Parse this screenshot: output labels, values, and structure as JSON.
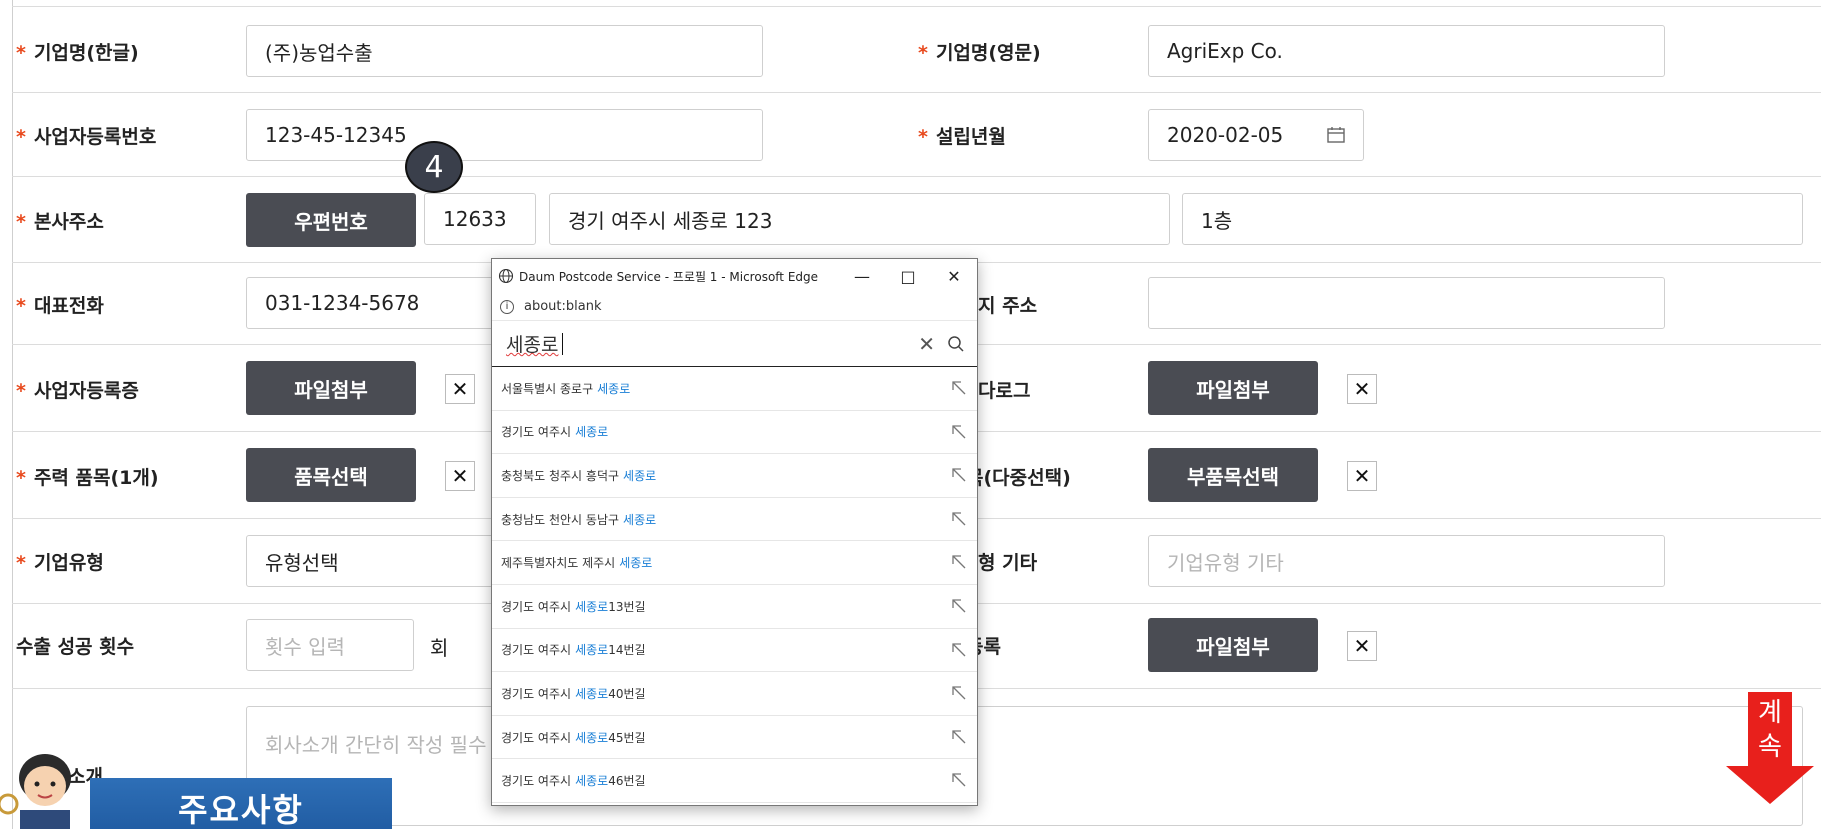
{
  "form": {
    "company_name_kr": {
      "label": "기업명(한글)",
      "value": "(주)농업수출"
    },
    "company_name_en": {
      "label": "기업명(영문)",
      "value": "AgriExp Co."
    },
    "business_reg_no": {
      "label": "사업자등록번호",
      "value": "123-45-12345"
    },
    "founded": {
      "label": "설립년월",
      "value": "2020-02-05"
    },
    "hq_address": {
      "label": "본사주소",
      "postcode_button": "우편번호",
      "postcode": "12633",
      "address": "경기 여주시 세종로 123",
      "detail": "1층"
    },
    "phone": {
      "label": "대표전화",
      "value": "031-1234-5678"
    },
    "site_address": {
      "label_partial": "지 주소",
      "value": ""
    },
    "biz_cert": {
      "label": "사업자등록증",
      "button": "파일첨부",
      "remove": "✕"
    },
    "catalog": {
      "label_partial": "다로그",
      "button": "파일첨부",
      "remove": "✕"
    },
    "main_item": {
      "label": "주력 품목(1개)",
      "button": "품목선택",
      "remove": "✕"
    },
    "sub_item": {
      "label_partial": "목(다중선택)",
      "button": "부품목선택",
      "remove": "✕"
    },
    "company_type": {
      "label": "기업유형",
      "value": "유형선택"
    },
    "company_type_etc": {
      "label_partial": "형 기타",
      "placeholder": "기업유형 기타"
    },
    "export_count": {
      "label": "수출 성공 횟수",
      "placeholder": "횟수 입력",
      "unit": "회"
    },
    "file_reg": {
      "label_partial": "등록",
      "button": "파일첨부",
      "remove": "✕"
    },
    "intro": {
      "label_partial": "소개",
      "placeholder": "회사소개 간단히 작성 필수"
    },
    "required_mark": "*"
  },
  "step_badge": "4",
  "popup": {
    "window_title": "Daum Postcode Service - 프로필 1 - Microsoft Edge",
    "url": "about:blank",
    "search_query": "세종로",
    "results": [
      {
        "prefix": "서울특별시 종로구",
        "road": "세종로",
        "suffix": ""
      },
      {
        "prefix": "경기도 여주시",
        "road": "세종로",
        "suffix": ""
      },
      {
        "prefix": "충청북도 청주시 흥덕구",
        "road": "세종로",
        "suffix": ""
      },
      {
        "prefix": "충청남도 천안시 동남구",
        "road": "세종로",
        "suffix": ""
      },
      {
        "prefix": "제주특별자치도 제주시",
        "road": "세종로",
        "suffix": ""
      },
      {
        "prefix": "경기도 여주시",
        "road": "세종로",
        "suffix": "13번길"
      },
      {
        "prefix": "경기도 여주시",
        "road": "세종로",
        "suffix": "14번길"
      },
      {
        "prefix": "경기도 여주시",
        "road": "세종로",
        "suffix": "40번길"
      },
      {
        "prefix": "경기도 여주시",
        "road": "세종로",
        "suffix": "45번길"
      },
      {
        "prefix": "경기도 여주시",
        "road": "세종로",
        "suffix": "46번길"
      }
    ]
  },
  "notice": {
    "title": "주요사항"
  },
  "continue": {
    "line1": "계",
    "line2": "속"
  },
  "colors": {
    "button_dark": "#4a4c53",
    "required": "#e8491d",
    "highlight": "#1a7fd6",
    "notice_blue": "#2e6fb7",
    "continue_red": "#e8201c"
  }
}
